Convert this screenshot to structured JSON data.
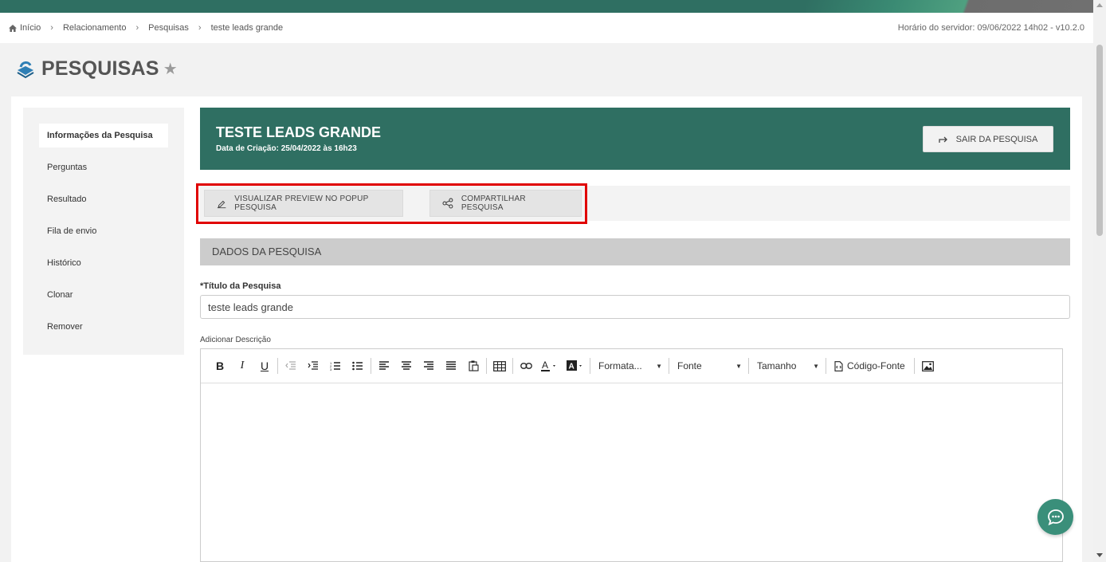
{
  "breadcrumb": {
    "items": [
      "Início",
      "Relacionamento",
      "Pesquisas",
      "teste leads grande"
    ],
    "server_time": "Horário do servidor: 09/06/2022 14h02 - v10.2.0"
  },
  "page": {
    "title": "PESQUISAS"
  },
  "sidebar": {
    "items": [
      {
        "label": "Informações da Pesquisa"
      },
      {
        "label": "Perguntas"
      },
      {
        "label": "Resultado"
      },
      {
        "label": "Fila de envio"
      },
      {
        "label": "Histórico"
      },
      {
        "label": "Clonar"
      },
      {
        "label": "Remover"
      }
    ]
  },
  "banner": {
    "title": "TESTE LEADS GRANDE",
    "created": "Data de Criação: 25/04/2022 às 16h23",
    "exit_label": "SAIR DA PESQUISA"
  },
  "actions": {
    "preview_label": "VISUALIZAR PREVIEW NO POPUP PESQUISA",
    "share_label": "COMPARTILHAR PESQUISA"
  },
  "section": {
    "title": "DADOS DA PESQUISA"
  },
  "form": {
    "title_label": "*Título da Pesquisa",
    "title_value": "teste leads grande",
    "desc_label": "Adicionar Descrição"
  },
  "editor": {
    "format_label": "Formata...",
    "font_label": "Fonte",
    "size_label": "Tamanho",
    "source_label": "Código-Fonte"
  },
  "colors": {
    "brand": "#2f6f62",
    "highlight": "#e00000",
    "chat": "#3a8f7a"
  }
}
